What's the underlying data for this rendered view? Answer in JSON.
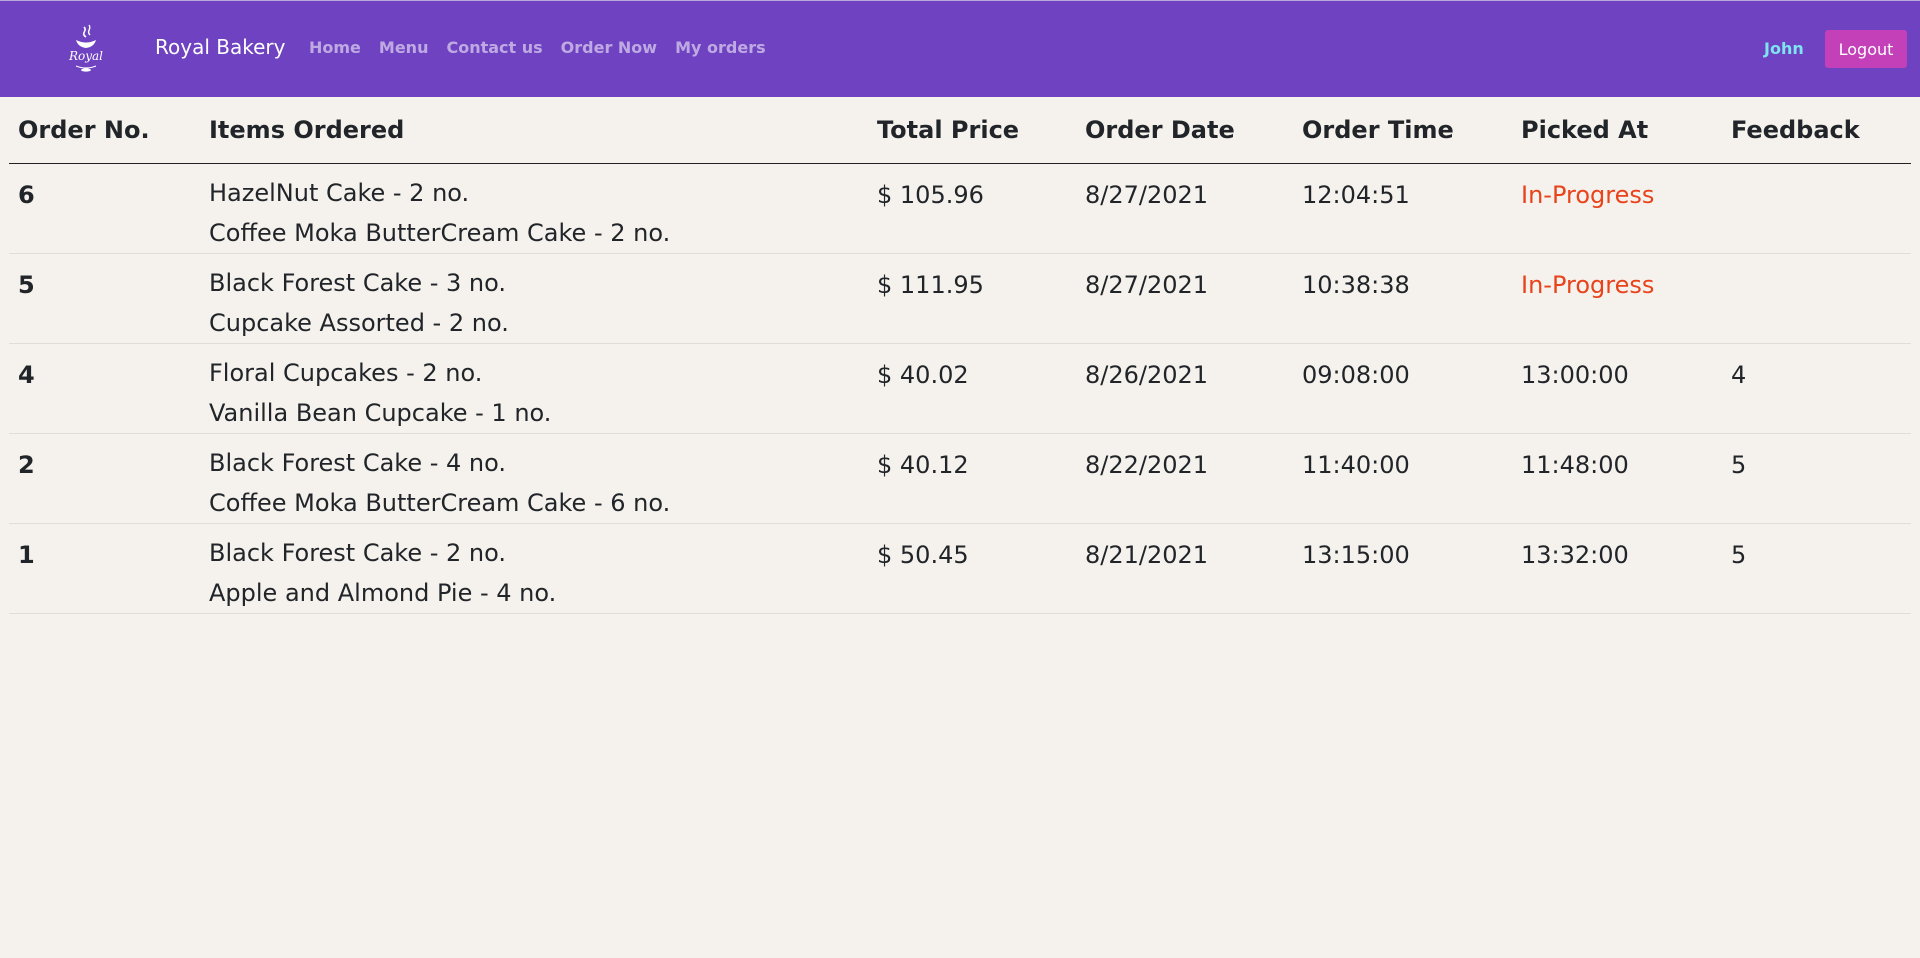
{
  "navbar": {
    "brand": "Royal Bakery",
    "logo_text": "Royal",
    "links": [
      "Home",
      "Menu",
      "Contact us",
      "Order Now",
      "My orders"
    ],
    "user": "John",
    "logout_label": "Logout",
    "colors": {
      "background": "#6f42c1",
      "logout": "#c440b8",
      "user": "#7fe3f0"
    }
  },
  "table": {
    "headers": [
      "Order No.",
      "Items Ordered",
      "Total Price",
      "Order Date",
      "Order Time",
      "Picked At",
      "Feedback"
    ],
    "rows": [
      {
        "order_no": "6",
        "items": [
          "HazelNut Cake - 2 no.",
          "Coffee Moka ButterCream Cake - 2 no."
        ],
        "total": "$ 105.96",
        "date": "8/27/2021",
        "time": "12:04:51",
        "picked": "In-Progress",
        "feedback": ""
      },
      {
        "order_no": "5",
        "items": [
          "Black Forest Cake - 3 no.",
          "Cupcake Assorted - 2 no."
        ],
        "total": "$ 111.95",
        "date": "8/27/2021",
        "time": "10:38:38",
        "picked": "In-Progress",
        "feedback": ""
      },
      {
        "order_no": "4",
        "items": [
          "Floral Cupcakes - 2 no.",
          "Vanilla Bean Cupcake - 1 no."
        ],
        "total": "$ 40.02",
        "date": "8/26/2021",
        "time": "09:08:00",
        "picked": "13:00:00",
        "feedback": "4"
      },
      {
        "order_no": "2",
        "items": [
          "Black Forest Cake - 4 no.",
          "Coffee Moka ButterCream Cake - 6 no."
        ],
        "total": "$ 40.12",
        "date": "8/22/2021",
        "time": "11:40:00",
        "picked": "11:48:00",
        "feedback": "5"
      },
      {
        "order_no": "1",
        "items": [
          "Black Forest Cake - 2 no.",
          "Apple and Almond Pie - 4 no."
        ],
        "total": "$ 50.45",
        "date": "8/21/2021",
        "time": "13:15:00",
        "picked": "13:32:00",
        "feedback": "5"
      }
    ],
    "in_progress_color": "#e8431b"
  }
}
